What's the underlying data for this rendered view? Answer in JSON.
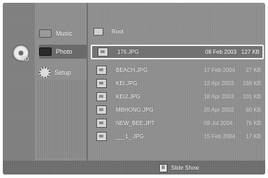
{
  "disc": {
    "label": "CD",
    "icon": "disc-icon"
  },
  "menu": {
    "items": [
      {
        "label": "Music",
        "icon": "music-icon"
      },
      {
        "label": "Photo",
        "icon": "photo-icon",
        "selected": true
      },
      {
        "label": "Setup",
        "icon": "gear-icon"
      }
    ]
  },
  "browser": {
    "root_label": "Root",
    "files": [
      {
        "name": "176.JPG",
        "date": "08 Feb 2003",
        "size": "127 KB",
        "selected": true
      },
      {
        "name": "BEACH.JPG",
        "date": "17 Feb 2004",
        "size": "27 KB"
      },
      {
        "name": "KEI.JPG",
        "date": "12 Apr 2003",
        "size": "168 KB"
      },
      {
        "name": "KEI2.JPG",
        "date": "18 Apr 2003",
        "size": "101 KB"
      },
      {
        "name": "MBHONG.JPG",
        "date": "20 Apr 2002",
        "size": "60 KB"
      },
      {
        "name": "NEW_BEE.JPT",
        "date": "08 Jul 2004",
        "size": "76 KB"
      },
      {
        "name": "___1_.JPG",
        "date": "15 Feb 2004",
        "size": "17 KB"
      }
    ]
  },
  "bottom": {
    "key_label": "B",
    "action_label": "Slide Show"
  }
}
